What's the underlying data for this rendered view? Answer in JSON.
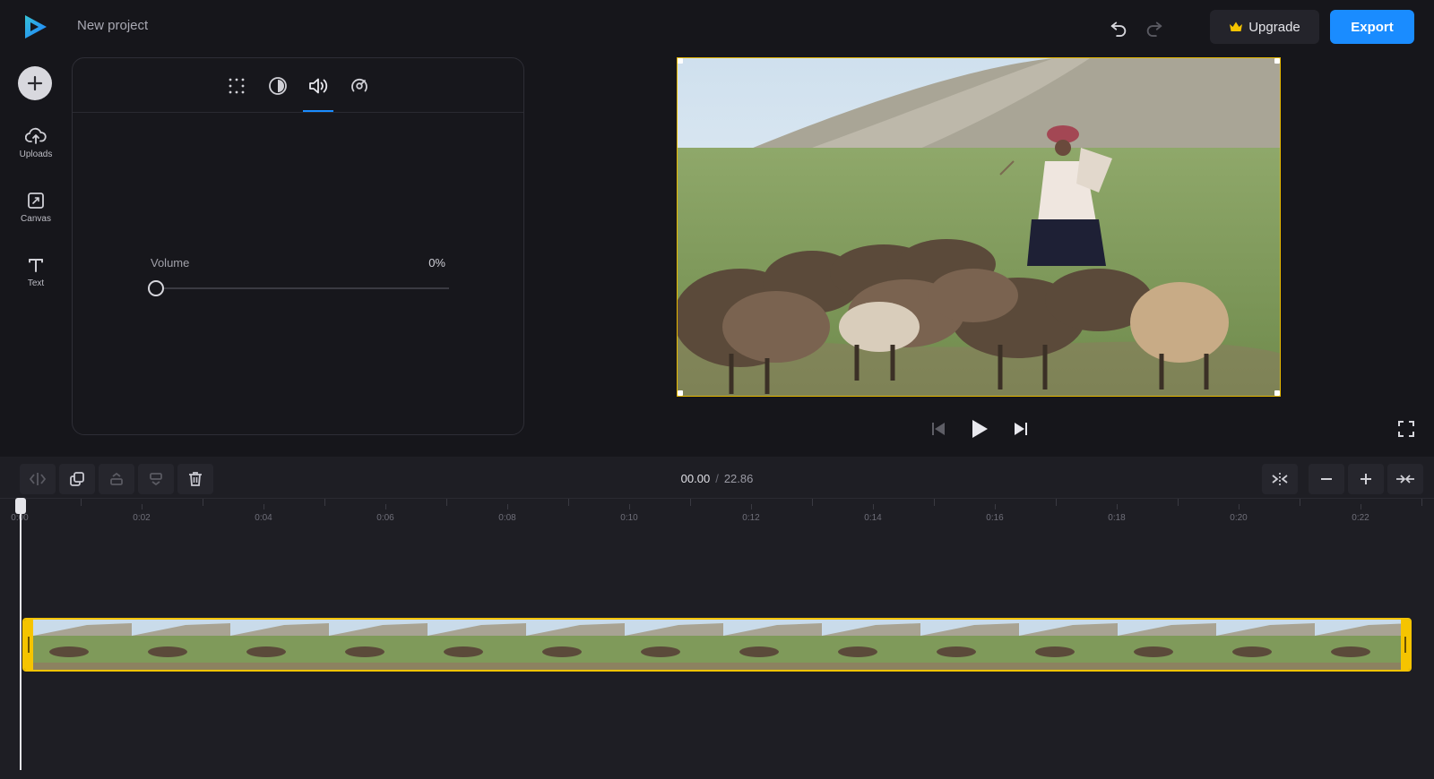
{
  "header": {
    "project_title": "New project",
    "upgrade_label": "Upgrade",
    "export_label": "Export"
  },
  "sidebar": {
    "items": [
      {
        "label": "Uploads",
        "icon": "upload-cloud-icon"
      },
      {
        "label": "Canvas",
        "icon": "canvas-icon"
      },
      {
        "label": "Text",
        "icon": "text-icon"
      }
    ]
  },
  "panel": {
    "tabs": [
      {
        "icon": "crop-icon"
      },
      {
        "icon": "filter-icon"
      },
      {
        "icon": "audio-icon",
        "active": true
      },
      {
        "icon": "speed-icon"
      }
    ],
    "volume": {
      "label": "Volume",
      "value_text": "0%",
      "value": 0
    }
  },
  "timeline": {
    "current_time": "00.00",
    "separator": "/",
    "total_time": "22.86",
    "ruler_labels": [
      "0:00",
      "0:02",
      "0:04",
      "0:06",
      "0:08",
      "0:10",
      "0:12",
      "0:14",
      "0:16",
      "0:18",
      "0:20",
      "0:22"
    ]
  },
  "colors": {
    "accent": "#1a8cff",
    "selection": "#f5c400",
    "background": "#16161b"
  }
}
